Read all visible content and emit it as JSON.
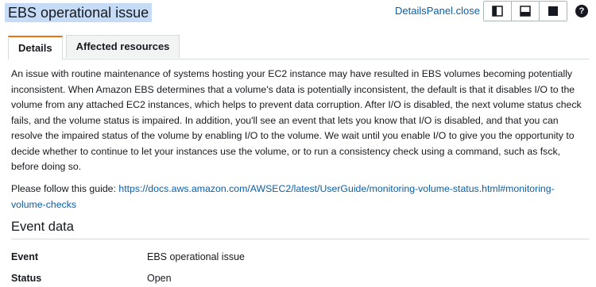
{
  "header": {
    "title": "EBS operational issue",
    "close_label": "DetailsPanel.close",
    "help_symbol": "?"
  },
  "tabs": [
    {
      "label": "Details",
      "active": true
    },
    {
      "label": "Affected resources",
      "active": false
    }
  ],
  "details": {
    "description": "An issue with routine maintenance of systems hosting your EC2 instance may have resulted in EBS volumes becoming potentially inconsistent. When Amazon EBS determines that a volume's data is potentially inconsistent, the default is that it disables I/O to the volume from any attached EC2 instances, which helps to prevent data corruption. After I/O is disabled, the next volume status check fails, and the volume status is impaired. In addition, you'll see an event that lets you know that I/O is disabled, and that you can resolve the impaired status of the volume by enabling I/O to the volume. We wait until you enable I/O to give you the opportunity to decide whether to continue to let your instances use the volume, or to run a consistency check using a command, such as fsck, before doing so.",
    "guide_prefix": "Please follow this guide: ",
    "guide_link": "https://docs.aws.amazon.com/AWSEC2/latest/UserGuide/monitoring-volume-status.html#monitoring-volume-checks"
  },
  "event_data": {
    "title": "Event data",
    "rows": [
      {
        "key": "Event",
        "value": "EBS operational issue"
      },
      {
        "key": "Status",
        "value": "Open"
      }
    ]
  },
  "colors": {
    "accent": "#ec7211",
    "link": "#0b5ea8",
    "selection": "#c5dbf6"
  },
  "icons": [
    "layout-side-icon",
    "layout-bottom-icon",
    "layout-full-icon",
    "help-icon"
  ]
}
